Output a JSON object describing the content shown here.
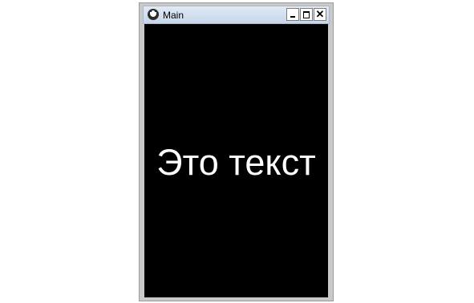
{
  "window": {
    "title": "Main",
    "icon": "kivy-app-icon",
    "controls": {
      "minimize": "minimize-icon",
      "maximize": "maximize-icon",
      "close": "close-icon",
      "close_glyph": "✕"
    }
  },
  "content": {
    "label_text": "Это текст",
    "background_color": "#000000",
    "text_color": "#ffffff"
  }
}
